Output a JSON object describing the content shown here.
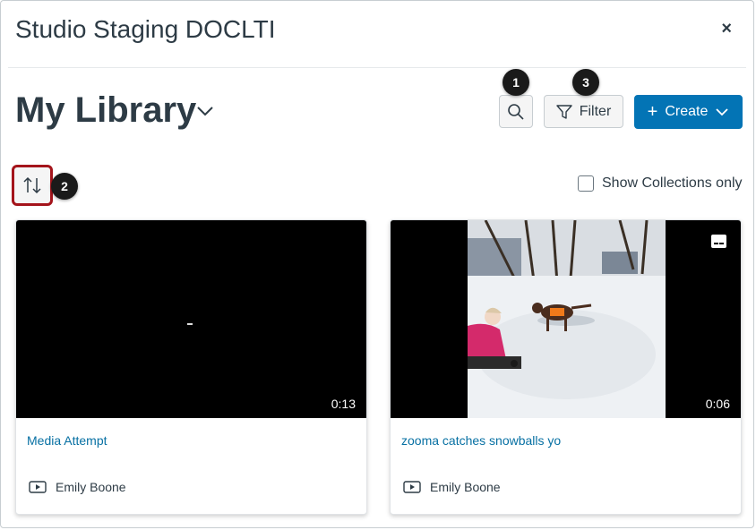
{
  "app": {
    "title": "Studio Staging DOCLTI",
    "close_label": "×"
  },
  "library": {
    "title": "My Library"
  },
  "toolbar": {
    "filter_label": "Filter",
    "create_label": "Create",
    "create_prefix": "+"
  },
  "options": {
    "show_collections_label": "Show Collections only",
    "show_collections_checked": false
  },
  "callouts": {
    "search": "1",
    "sort": "2",
    "filter": "3"
  },
  "media": [
    {
      "title": "Media Attempt",
      "duration": "0:13",
      "author": "Emily Boone",
      "captions": false
    },
    {
      "title": "zooma catches snowballs yo",
      "duration": "0:06",
      "author": "Emily Boone",
      "captions": true
    }
  ],
  "colors": {
    "brand": "#0374b5",
    "link": "#0770a3",
    "highlight": "#a4141b",
    "text": "#2d3b45"
  },
  "icons": {
    "search": "search-icon",
    "filter": "filter-icon",
    "sort": "sort-icon",
    "chevron": "chevron-down-icon",
    "media": "video-icon",
    "captions": "closed-captions-icon"
  }
}
